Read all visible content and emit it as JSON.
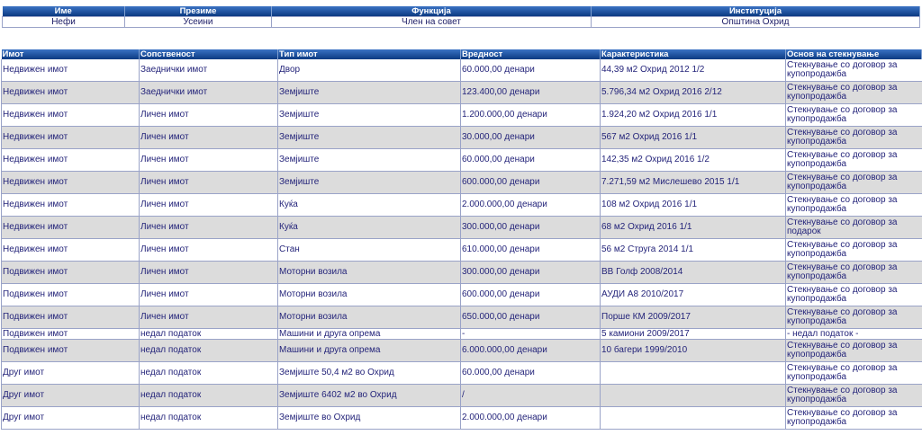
{
  "person_table": {
    "headers": [
      "Име",
      "Презиме",
      "Функција",
      "Институција"
    ],
    "row": [
      "Нефи",
      "Усеини",
      "Член на совет",
      "Општина Охрид"
    ]
  },
  "assets_table": {
    "headers": [
      "Имот",
      "Сопственост",
      "Тип имот",
      "Вредност",
      "Карактеристика",
      "Основ на стекнување"
    ],
    "rows": [
      [
        "Недвижен имот",
        "Заеднички имот",
        "Двор",
        "60.000,00 денари",
        "44,39 м2 Охрид 2012 1/2",
        "Стекнување со договор за купопродажба"
      ],
      [
        "Недвижен имот",
        "Заеднички имот",
        "Земјиште",
        "123.400,00 денари",
        "5.796,34 м2 Охрид 2016 2/12",
        "Стекнување со договор за купопродажба"
      ],
      [
        "Недвижен имот",
        "Личен имот",
        "Земјиште",
        "1.200.000,00 денари",
        "1.924,20 м2 Охрид 2016 1/1",
        "Стекнување со договор за купопродажба"
      ],
      [
        "Недвижен имот",
        "Личен имот",
        "Земјиште",
        "30.000,00 денари",
        "567 м2 Охрид 2016 1/1",
        "Стекнување со договор за купопродажба"
      ],
      [
        "Недвижен имот",
        "Личен имот",
        "Земјиште",
        "60.000,00 денари",
        "142,35 м2 Охрид 2016 1/2",
        "Стекнување со договор за купопродажба"
      ],
      [
        "Недвижен имот",
        "Личен имот",
        "Земјиште",
        "600.000,00 денари",
        "7.271,59 м2 Мислешево 2015 1/1",
        "Стекнување со договор за купопродажба"
      ],
      [
        "Недвижен имот",
        "Личен имот",
        "Куќа",
        "2.000.000,00 денари",
        "108 м2 Охрид 2016 1/1",
        "Стекнување со договор за купопродажба"
      ],
      [
        "Недвижен имот",
        "Личен имот",
        "Куќа",
        "300.000,00 денари",
        "68 м2 Охрид 2016 1/1",
        "Стекнување со договор за подарок"
      ],
      [
        "Недвижен имот",
        "Личен имот",
        "Стан",
        "610.000,00 денари",
        "56 м2 Струга 2014 1/1",
        "Стекнување со договор за купопродажба"
      ],
      [
        "Подвижен имот",
        "Личен имот",
        "Моторни возила",
        "300.000,00 денари",
        "ВВ Голф 2008/2014",
        "Стекнување со договор за купопродажба"
      ],
      [
        "Подвижен имот",
        "Личен имот",
        "Моторни возила",
        "600.000,00 денари",
        "АУДИ А8 2010/2017",
        "Стекнување со договор за купопродажба"
      ],
      [
        "Подвижен имот",
        "Личен имот",
        "Моторни возила",
        "650.000,00 денари",
        "Порше КМ 2009/2017",
        "Стекнување со договор за купопродажба"
      ],
      [
        "Подвижен имот",
        "недал податок",
        "Машини и друга опрема",
        "-",
        "5 камиони 2009/2017",
        "- недал податок -"
      ],
      [
        "Подвижен имот",
        "недал податок",
        "Машини и друга опрема",
        "6.000.000,00 денари",
        "10 багери 1999/2010",
        "Стекнување со договор за купопродажба"
      ],
      [
        "Друг имот",
        "недал податок",
        "Земјиште 50,4 м2 во Охрид",
        "60.000,00 денари",
        "",
        "Стекнување со договор за купопродажба"
      ],
      [
        "Друг имот",
        "недал податок",
        "Земјиште 6402 м2 во Охрид",
        "/",
        "",
        "Стекнување со договор за купопродажба"
      ],
      [
        "Друг имот",
        "недал податок",
        "Земјиште во Охрид",
        "2.000.000,00 денари",
        "",
        "Стекнување со договор за купопродажба"
      ]
    ]
  }
}
